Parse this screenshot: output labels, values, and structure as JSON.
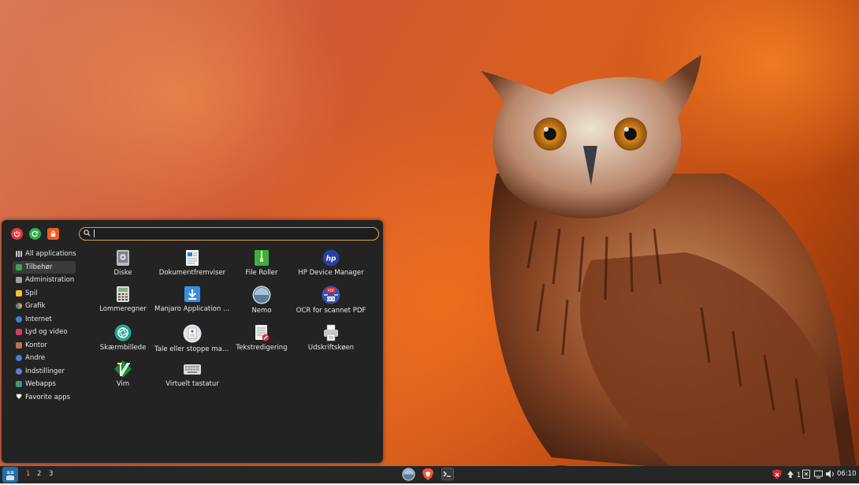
{
  "menu": {
    "session": [
      {
        "name": "power-icon",
        "color": "#e23b3b"
      },
      {
        "name": "logout-icon",
        "color": "#2fb24b"
      },
      {
        "name": "lock-icon",
        "color": "#f05a24"
      }
    ],
    "search": {
      "value": "",
      "accent": "#e8a33b"
    },
    "categories": [
      {
        "label": "All applications",
        "selected": false,
        "color": "#cccccc"
      },
      {
        "label": "Tilbehør",
        "selected": true,
        "color": "#3fa34d"
      },
      {
        "label": "Administration",
        "selected": false,
        "color": "#9aa0a6"
      },
      {
        "label": "Spil",
        "selected": false,
        "color": "#f2c033"
      },
      {
        "label": "Grafik",
        "selected": false,
        "color": "#e8553b"
      },
      {
        "label": "Internet",
        "selected": false,
        "color": "#3f7fd9"
      },
      {
        "label": "Lyd og video",
        "selected": false,
        "color": "#d23d6a"
      },
      {
        "label": "Kontor",
        "selected": false,
        "color": "#b9764a"
      },
      {
        "label": "Andre",
        "selected": false,
        "color": "#4a7fd4"
      },
      {
        "label": "Indstillinger",
        "selected": false,
        "color": "#5b7fdb"
      },
      {
        "label": "Webapps",
        "selected": false,
        "color": "#3fa34d"
      },
      {
        "label": "Favorite apps",
        "selected": false,
        "color": "#ffffff"
      }
    ],
    "apps": [
      {
        "label": "Diske",
        "icon": "disks-icon"
      },
      {
        "label": "Dokumentfremviser",
        "icon": "document-viewer-icon"
      },
      {
        "label": "File Roller",
        "icon": "file-roller-icon"
      },
      {
        "label": "HP Device Manager",
        "icon": "hp-icon"
      },
      {
        "label": "Lommeregner",
        "icon": "calculator-icon"
      },
      {
        "label": "Manjaro Application Utility",
        "icon": "manjaro-apps-icon"
      },
      {
        "label": "Nemo",
        "icon": "nemo-icon"
      },
      {
        "label": "OCR for scannet PDF",
        "icon": "ocr-pdf-icon"
      },
      {
        "label": "Skærmbillede",
        "icon": "screenshot-icon"
      },
      {
        "label": "Tale eller stoppe maskinen",
        "icon": "speech-icon"
      },
      {
        "label": "Tekstredigering",
        "icon": "text-editor-icon"
      },
      {
        "label": "Udskriftskøen",
        "icon": "printer-icon"
      },
      {
        "label": "Vim",
        "icon": "vim-icon"
      },
      {
        "label": "Virtuelt tastatur",
        "icon": "keyboard-icon"
      }
    ]
  },
  "panel": {
    "workspaces": [
      "1",
      "2",
      "3"
    ],
    "active_workspace": "1",
    "taskbar": [
      "nemo-icon",
      "brave-icon",
      "terminal-icon"
    ],
    "tray": {
      "update_count": "1"
    },
    "clock": "06:10"
  }
}
